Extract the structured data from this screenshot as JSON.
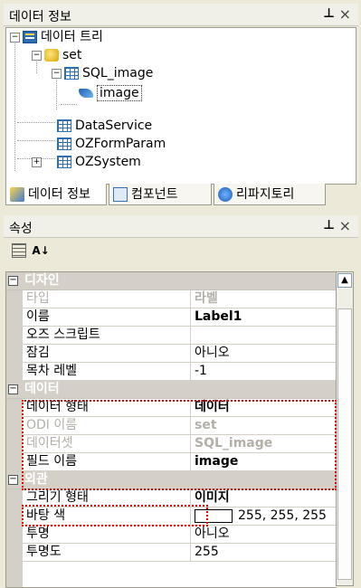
{
  "data_panel": {
    "title": "데이터 정보",
    "pin_icon": "pin-icon",
    "close_icon": "close-icon",
    "tree": [
      {
        "label": "데이터 트리",
        "icon": "tree-root-icon",
        "expander": "−"
      },
      {
        "label": "set",
        "icon": "dataset-icon",
        "expander": "−"
      },
      {
        "label": "SQL_image",
        "icon": "grid-icon",
        "expander": "−"
      },
      {
        "label": "image",
        "icon": "field-icon"
      },
      {
        "label": "DataService",
        "icon": "grid-icon"
      },
      {
        "label": "OZFormParam",
        "icon": "grid-icon"
      },
      {
        "label": "OZSystem",
        "icon": "grid-icon",
        "expander": "+"
      }
    ],
    "tabs": [
      {
        "label": "데이터 정보",
        "icon": "data-info-icon"
      },
      {
        "label": "컴포넌트",
        "icon": "component-icon"
      },
      {
        "label": "리파지토리",
        "icon": "repository-icon"
      }
    ]
  },
  "props_panel": {
    "title": "속성",
    "toolbar": [
      {
        "icon": "categorized-icon",
        "label": ""
      },
      {
        "icon": "sort-az-icon",
        "label": "A↓"
      }
    ],
    "categories": [
      {
        "label": "디자인",
        "rows": [
          {
            "name": "타입",
            "value": "라벨",
            "disabled": true
          },
          {
            "name": "이름",
            "value": "Label1",
            "bold": true
          },
          {
            "name": "오즈 스크립트",
            "value": ""
          },
          {
            "name": "잠김",
            "value": "아니오"
          },
          {
            "name": "목차 레벨",
            "value": "-1"
          }
        ]
      },
      {
        "label": "데이터",
        "rows": [
          {
            "name": "데이터 형태",
            "value": "데이터",
            "bold": true
          },
          {
            "name": "ODI 이름",
            "value": "set",
            "disabled": true
          },
          {
            "name": "데이터셋",
            "value": "SQL_image",
            "disabled": true
          },
          {
            "name": "필드 이름",
            "value": "image",
            "bold": true
          }
        ]
      },
      {
        "label": "외관",
        "rows": [
          {
            "name": "그리기 형태",
            "value": "이미지",
            "bold": true
          },
          {
            "name": "바탕 색",
            "value": "255, 255, 255",
            "swatch": "#ffffff"
          },
          {
            "name": "투명",
            "value": "아니오"
          },
          {
            "name": "투명도",
            "value": "255"
          }
        ]
      }
    ]
  },
  "colors": {
    "highlight_box": "#e10000"
  }
}
